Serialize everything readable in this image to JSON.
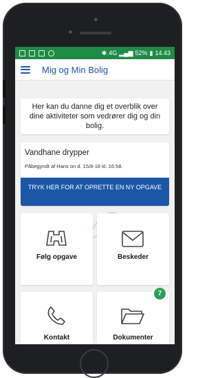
{
  "status_bar": {
    "signal": "4G",
    "battery": "52%",
    "time": "14.43"
  },
  "app_bar": {
    "title": "Mig og Min Bolig",
    "menu_icon": "hamburger-menu-icon"
  },
  "intro_text": "Her kan du danne dig et overblik over dine aktiviteter som vedrører dig og din bolig.",
  "task_card": {
    "title": "Vandhane drypper",
    "subtitle": "Påbegyndt af Hans on d. 15/8-18 kl. 16:58.",
    "button_label": "TRYK HER FOR AT OPRETTE EN NY OPGAVE"
  },
  "tiles": [
    {
      "label": "Følg opgave",
      "icon": "binoculars-icon"
    },
    {
      "label": "Beskeder",
      "icon": "envelope-icon"
    },
    {
      "label": "Kontakt",
      "icon": "phone-icon"
    },
    {
      "label": "Dokumenter",
      "icon": "folder-icon",
      "badge": "7"
    }
  ],
  "colors": {
    "accent": "#1b57a6",
    "status_bar": "#1f8b45",
    "badge": "#27a05a"
  }
}
